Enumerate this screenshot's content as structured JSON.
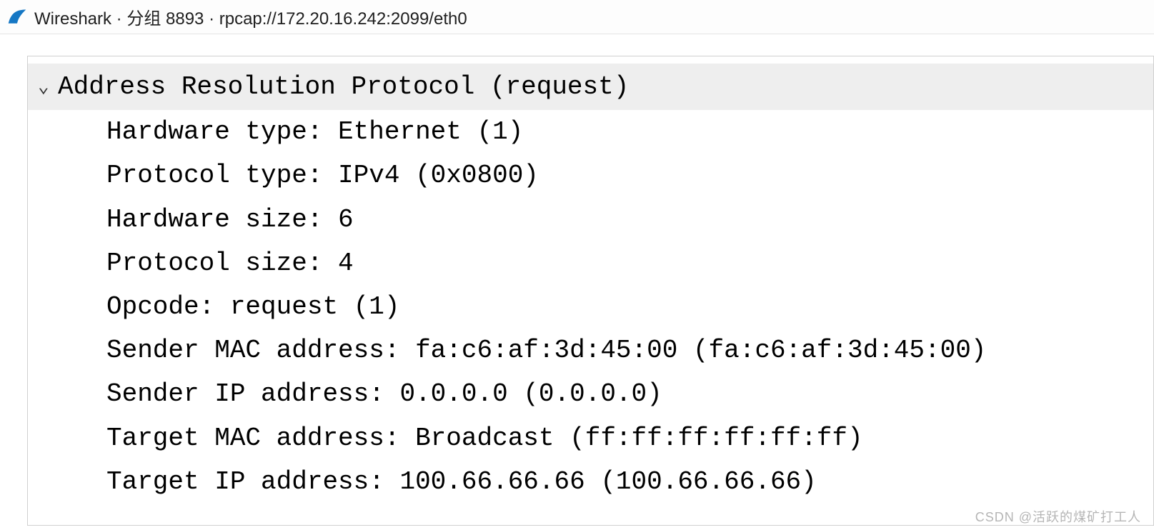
{
  "title": "Wireshark · 分组 8893 · rpcap://172.20.16.242:2099/eth0",
  "protocol_header": "Address Resolution Protocol (request)",
  "fields": {
    "hardware_type": "Hardware type: Ethernet (1)",
    "protocol_type": "Protocol type: IPv4 (0x0800)",
    "hardware_size": "Hardware size: 6",
    "protocol_size": "Protocol size: 4",
    "opcode": "Opcode: request (1)",
    "sender_mac": "Sender MAC address: fa:c6:af:3d:45:00 (fa:c6:af:3d:45:00)",
    "sender_ip": "Sender IP address: 0.0.0.0 (0.0.0.0)",
    "target_mac": "Target MAC address: Broadcast (ff:ff:ff:ff:ff:ff)",
    "target_ip": "Target IP address: 100.66.66.66 (100.66.66.66)"
  },
  "watermark": "CSDN @活跃的煤矿打工人"
}
